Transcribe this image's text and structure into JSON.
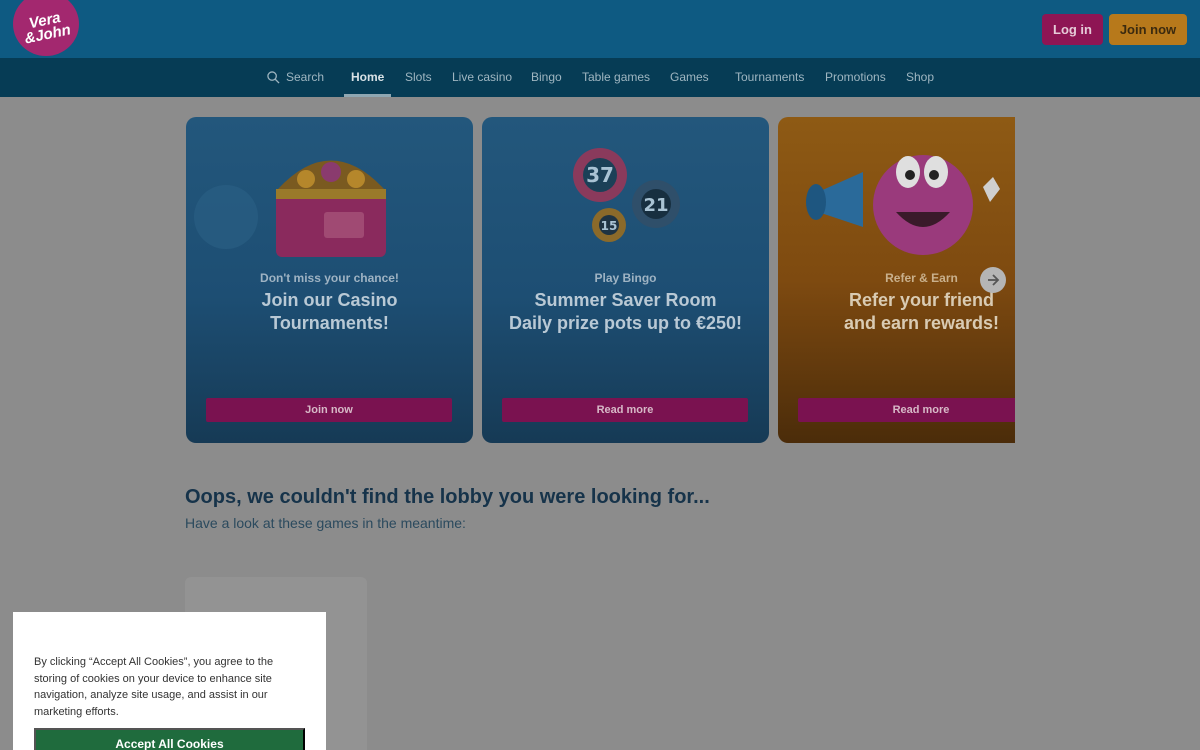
{
  "header": {
    "logo_text": "Vera\n&John",
    "login_label": "Log in",
    "join_label": "Join now"
  },
  "nav": {
    "search_label": "Search",
    "items": [
      "Home",
      "Slots",
      "Live casino",
      "Bingo",
      "Table games",
      "Games",
      "Tournaments",
      "Promotions",
      "Shop"
    ],
    "active": "Home"
  },
  "cards": [
    {
      "subtitle": "Don't miss your chance!",
      "title": "Join our Casino\nTournaments!",
      "button": "Join now"
    },
    {
      "subtitle": "Play Bingo",
      "title": "Summer Saver Room\nDaily prize pots up to €250!",
      "button": "Read more",
      "balls": [
        "37",
        "21",
        "15"
      ]
    },
    {
      "subtitle": "Refer & Earn",
      "title": "Refer your friend\nand earn rewards!",
      "button": "Read more"
    }
  ],
  "main": {
    "heading": "Oops, we couldn't find the lobby you were looking for...",
    "subheading": "Have a look at these games in the meantime:"
  },
  "cookie": {
    "text": "By clicking “Accept All Cookies”, you agree to the storing of cookies on your device to enhance site navigation, analyze site usage, and assist in our marketing efforts.",
    "accept_label": "Accept All Cookies"
  },
  "colors": {
    "header_bg": "#0e5a82",
    "nav_bg": "#063c55",
    "login_bg": "#8e1554",
    "join_bg": "#b7791b",
    "card_button": "#7a1250",
    "cookie_accept": "#1f6b3d"
  }
}
